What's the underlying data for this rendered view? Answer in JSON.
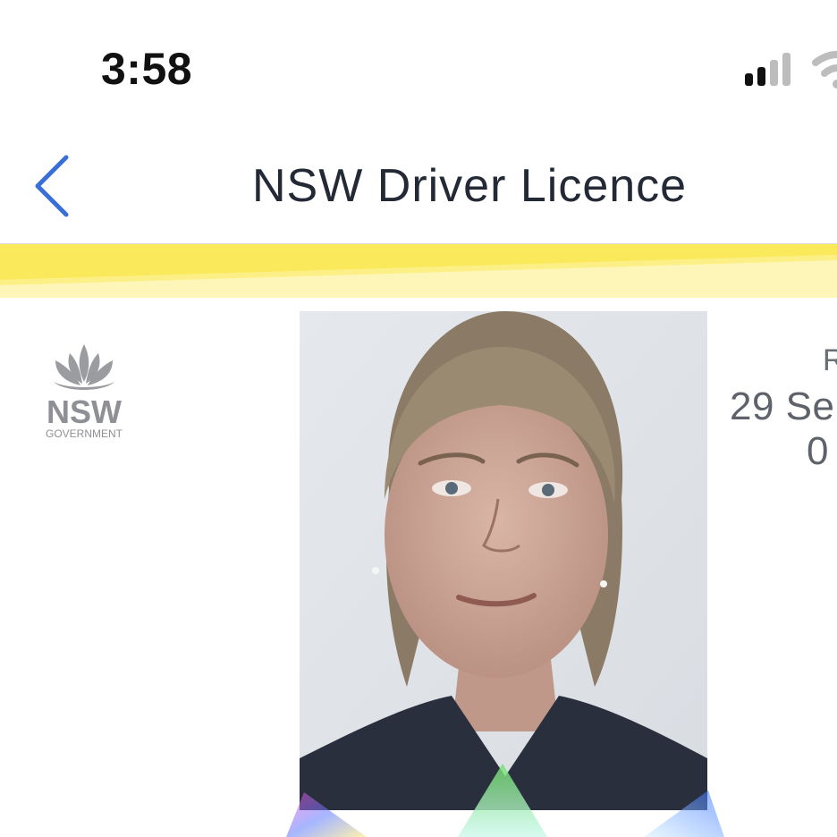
{
  "status_bar": {
    "time": "3:58"
  },
  "nav": {
    "title": "NSW Driver Licence",
    "back_icon": "chevron-left-icon"
  },
  "licence": {
    "logo_text": "NSW",
    "logo_subtext": "GOVERNMENT",
    "right_label": "R",
    "right_date": "29 Se",
    "right_sub": "0"
  },
  "colors": {
    "accent": "#3a6fd8",
    "band_yellow": "#fbe95c",
    "band_pale": "#fdf6b8",
    "title_text": "#232a36",
    "muted_text": "#5e636b"
  }
}
